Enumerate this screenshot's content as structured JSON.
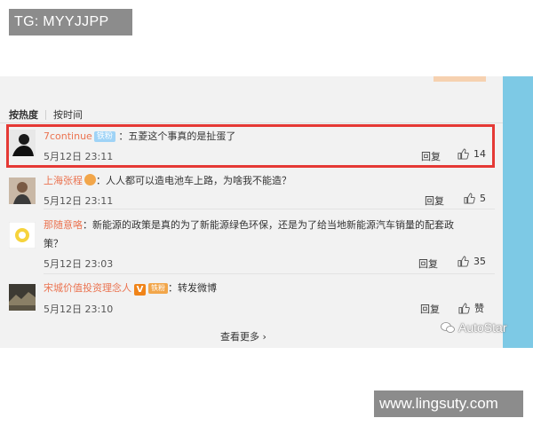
{
  "watermark_top": "TG: MYYJJPP",
  "watermark_bottom": "www.lingsuty.com",
  "watermark_brand": "AutoStar",
  "tabs": {
    "hot": "按热度",
    "time": "按时间"
  },
  "comments": [
    {
      "user": "7continue",
      "badge": "铁粉",
      "text": "：五菱这个事真的是扯蛋了",
      "time": "5月12日 23:11",
      "reply": "回复",
      "likes": "14",
      "highlighted": true
    },
    {
      "user": "上海张程",
      "text": "：人人都可以造电池车上路，为啥我不能造？",
      "time": "5月12日 23:11",
      "reply": "回复",
      "likes": "5"
    },
    {
      "user": "那随意咯",
      "text_line1": "：新能源的政策是真的为了新能源绿色环保，还是为了给当地新能源汽车销量的配套政",
      "text_line2": "策？",
      "time": "5月12日 23:03",
      "reply": "回复",
      "likes": "35"
    },
    {
      "user": "宋城价值投资理念人",
      "badge_v": "V",
      "badge_tag": "铁粉",
      "text": "：转发微博",
      "time": "5月12日 23:10",
      "reply": "回复",
      "likes": "赞"
    }
  ],
  "more": "查看更多",
  "colors": {
    "username": "#eb7350",
    "highlight": "#e53935",
    "blue_bar": "#7dc9e5"
  }
}
